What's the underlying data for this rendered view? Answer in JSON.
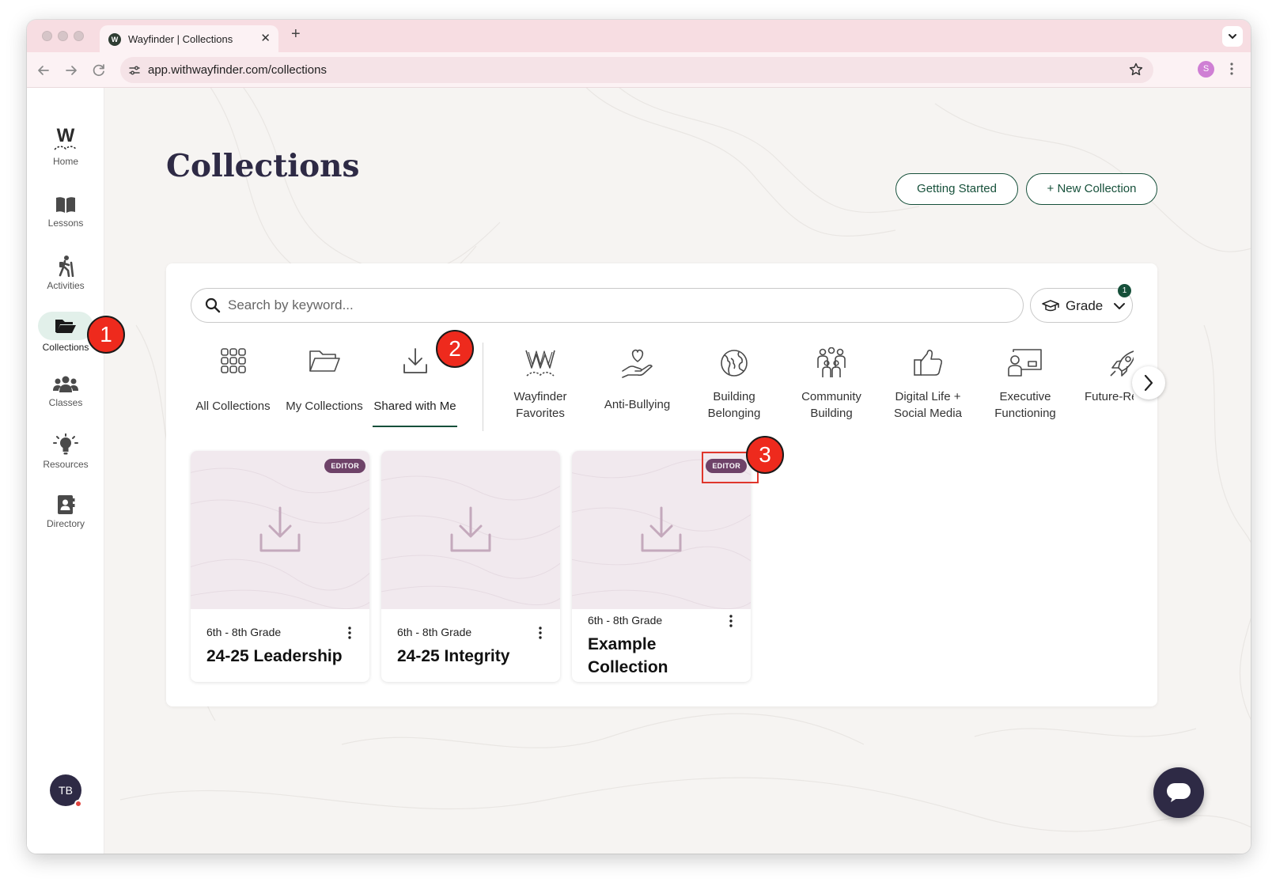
{
  "browser": {
    "tab_title": "Wayfinder | Collections",
    "favicon_letter": "W",
    "url_host": "app.withwayfinder.com",
    "url_path": "/collections",
    "profile_initial": "S"
  },
  "sidebar": {
    "items": [
      {
        "label": "Home",
        "icon": "wayfinder-logo-icon"
      },
      {
        "label": "Lessons",
        "icon": "book-icon"
      },
      {
        "label": "Activities",
        "icon": "hiker-icon"
      },
      {
        "label": "Collections",
        "icon": "folder-open-icon",
        "active": true
      },
      {
        "label": "Classes",
        "icon": "users-icon"
      },
      {
        "label": "Resources",
        "icon": "lightbulb-icon"
      },
      {
        "label": "Directory",
        "icon": "contact-book-icon"
      }
    ],
    "user_initials": "TB"
  },
  "page": {
    "title": "Collections",
    "getting_started": "Getting Started",
    "new_collection": "+ New Collection"
  },
  "search": {
    "placeholder": "Search by keyword...",
    "grade_label": "Grade",
    "grade_count": "1"
  },
  "categories": [
    {
      "label": "All Collections",
      "icon": "grid-icon"
    },
    {
      "label": "My Collections",
      "icon": "folder-open-icon"
    },
    {
      "label": "Shared with Me",
      "icon": "download-icon",
      "active": true
    },
    {
      "label": "Wayfinder Favorites",
      "icon": "wayfinder-logo-icon"
    },
    {
      "label": "Anti-Bullying",
      "icon": "heart-hand-icon"
    },
    {
      "label": "Building Belonging",
      "icon": "globe-icon"
    },
    {
      "label": "Community Building",
      "icon": "community-icon"
    },
    {
      "label": "Digital Life + Social Media",
      "icon": "thumbs-up-icon"
    },
    {
      "label": "Executive Functioning",
      "icon": "presenter-icon"
    },
    {
      "label": "Future-Ready Skills",
      "icon": "rocket-icon"
    }
  ],
  "cards": [
    {
      "grade": "6th - 8th Grade",
      "title": "24-25 Leadership",
      "badge": "EDITOR"
    },
    {
      "grade": "6th - 8th Grade",
      "title": "24-25 Integrity",
      "badge": ""
    },
    {
      "grade": "6th - 8th Grade",
      "title": "Example Collection",
      "badge": "EDITOR"
    }
  ],
  "annotations": [
    "1",
    "2",
    "3"
  ],
  "colors": {
    "brand_green": "#16503a",
    "brand_navy": "#2e2a45",
    "editor_badge": "#6e4268",
    "annotation_red": "#ee2a1d",
    "tab_bar_pink": "#f7dde2"
  }
}
